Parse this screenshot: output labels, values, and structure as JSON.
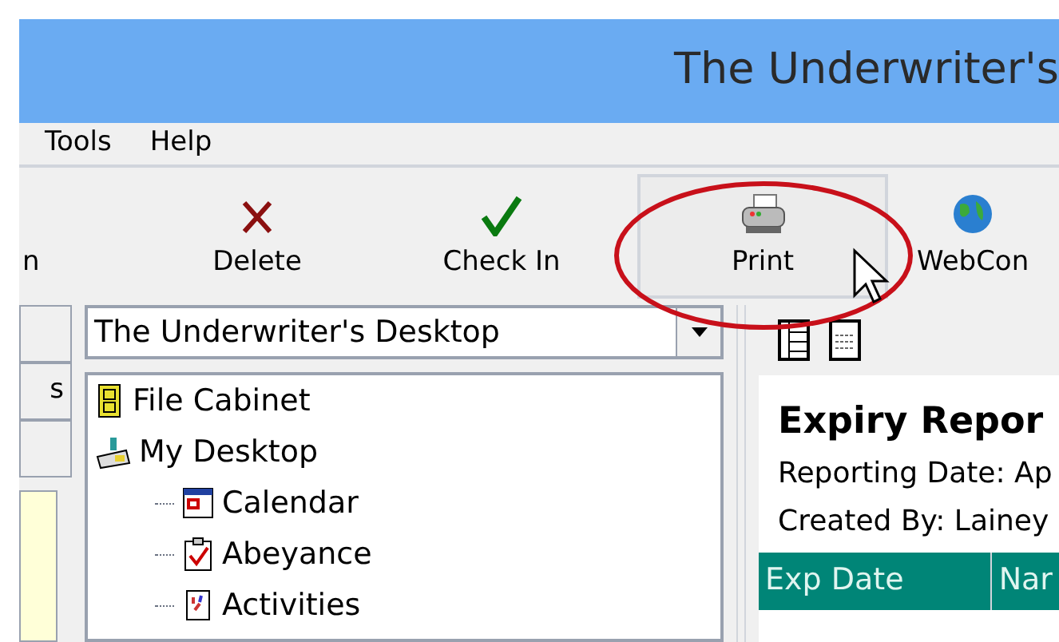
{
  "window": {
    "title": "The Underwriter's"
  },
  "menu": [
    "Tools",
    "Help"
  ],
  "toolbar": [
    {
      "label": "n",
      "kind": "partial",
      "hovered": false
    },
    {
      "label": "Delete",
      "kind": "delete",
      "hovered": false
    },
    {
      "label": "Check In",
      "kind": "checkin",
      "hovered": false
    },
    {
      "label": "Print",
      "kind": "print",
      "hovered": true
    },
    {
      "label": "WebCon",
      "kind": "web",
      "hovered": false
    }
  ],
  "side_tabs": [
    {
      "kind": "blank"
    },
    {
      "kind": "label",
      "label": "s"
    },
    {
      "kind": "blank"
    }
  ],
  "desktop_select": {
    "value": "The Underwriter's Desktop"
  },
  "tree": [
    {
      "label": "File Cabinet",
      "kind": "cabinet"
    },
    {
      "label": "My Desktop",
      "kind": "desktop",
      "children": [
        {
          "label": "Calendar",
          "kind": "calendar"
        },
        {
          "label": "Abeyance",
          "kind": "abeyance"
        },
        {
          "label": "Activities",
          "kind": "activities"
        }
      ]
    }
  ],
  "report": {
    "title": "Expiry Repor",
    "lines": [
      "Reporting Date: Ap",
      "Created By: Lainey"
    ],
    "columns": [
      "Exp Date",
      "Nar"
    ]
  }
}
